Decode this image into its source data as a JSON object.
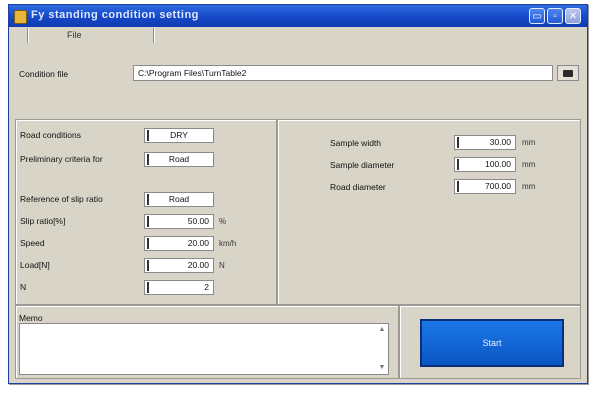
{
  "window": {
    "title": "Fy   standing condition setting",
    "controls": {
      "minimize": "▭",
      "maximize": "▫",
      "close": "✕"
    }
  },
  "menu": {
    "items": [
      "File"
    ]
  },
  "condition_file": {
    "label": "Condition file",
    "path": "C:\\Program Files\\TurnTable2",
    "browse_icon": "folder-icon"
  },
  "left_panel": {
    "road_conditions": {
      "label": "Road conditions",
      "value": "DRY"
    },
    "preliminary_criteria": {
      "label": "Preliminary criteria for",
      "value": "Road"
    },
    "reference_slip_ratio": {
      "label": "Reference of slip ratio",
      "value": "Road"
    },
    "slip_ratio": {
      "label": "Slip ratio[%]",
      "value": "50.00",
      "unit": "%"
    },
    "speed": {
      "label": "Speed",
      "value": "20.00",
      "unit": "km/h"
    },
    "load": {
      "label": "Load[N]",
      "value": "20.00",
      "unit": "N"
    },
    "n": {
      "label": "N",
      "value": "2"
    }
  },
  "right_panel": {
    "sample_width": {
      "label": "Sample width",
      "value": "30.00",
      "unit": "mm"
    },
    "sample_diameter": {
      "label": "Sample diameter",
      "value": "100.00",
      "unit": "mm"
    },
    "road_diameter": {
      "label": "Road diameter",
      "value": "700.00",
      "unit": "mm"
    }
  },
  "memo": {
    "label": "Memo",
    "value": ""
  },
  "start_button": {
    "label": "Start"
  },
  "colors": {
    "title_bar": "#1548c8",
    "start_button": "#0a55c4",
    "window_bg": "#d8d4c8"
  }
}
